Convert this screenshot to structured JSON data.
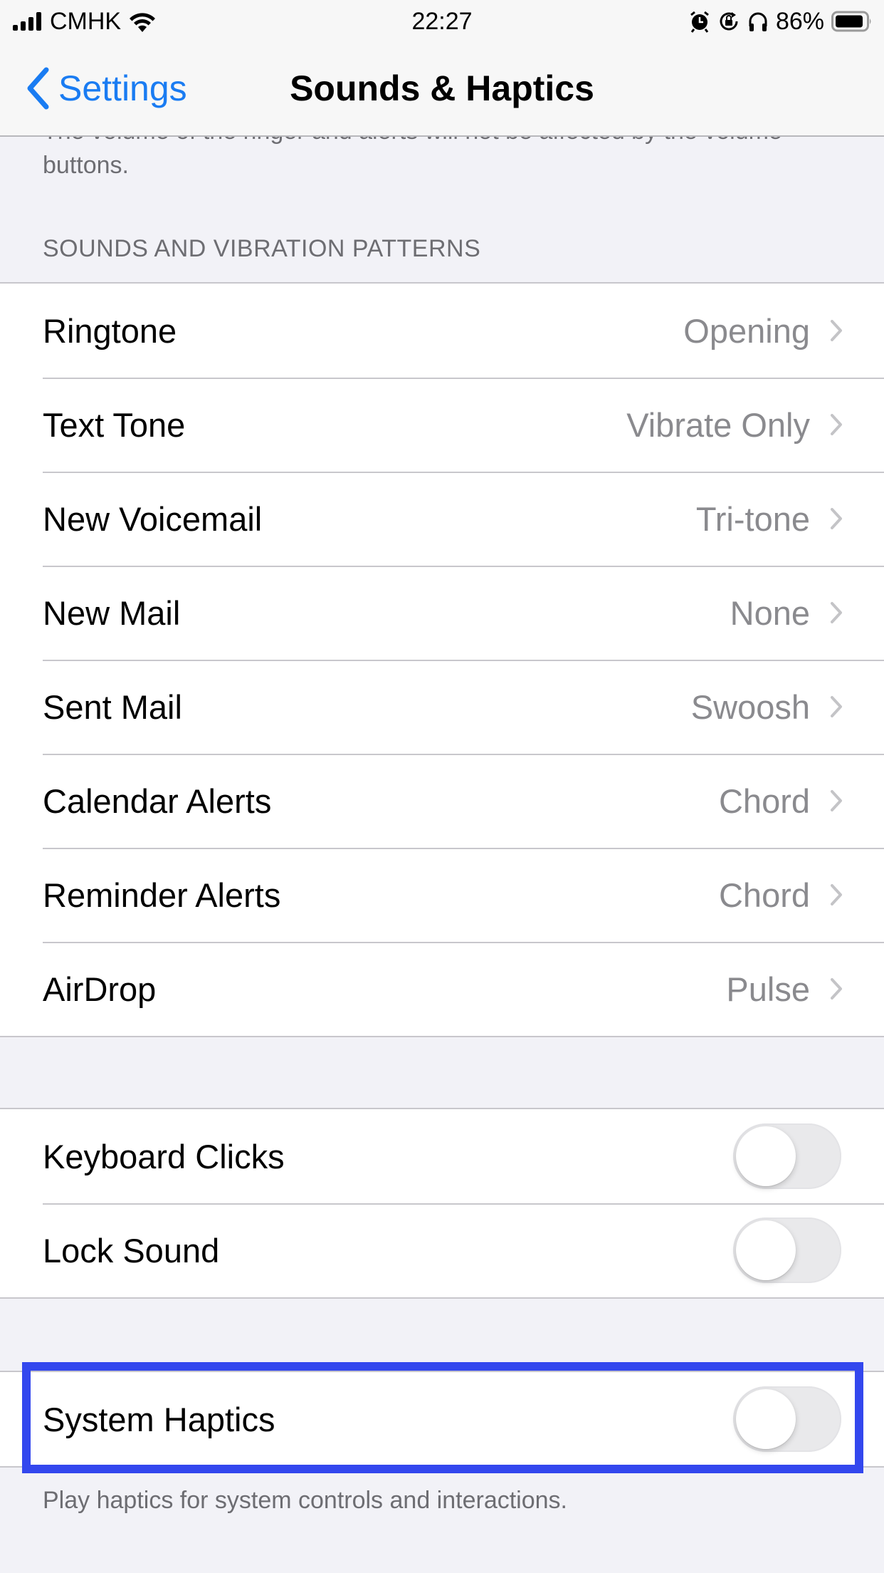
{
  "status_bar": {
    "carrier": "CMHK",
    "time": "22:27",
    "battery_percent": "86%",
    "icons": [
      "signal-icon",
      "wifi-icon",
      "alarm-icon",
      "orientation-lock-icon",
      "headphones-icon",
      "battery-icon"
    ]
  },
  "nav": {
    "back_label": "Settings",
    "title": "Sounds & Haptics"
  },
  "top_footnote": "The volume of the ringer and alerts will not be affected by the volume buttons.",
  "sounds_section": {
    "header": "SOUNDS AND VIBRATION PATTERNS",
    "rows": [
      {
        "label": "Ringtone",
        "value": "Opening"
      },
      {
        "label": "Text Tone",
        "value": "Vibrate Only"
      },
      {
        "label": "New Voicemail",
        "value": "Tri-tone"
      },
      {
        "label": "New Mail",
        "value": "None"
      },
      {
        "label": "Sent Mail",
        "value": "Swoosh"
      },
      {
        "label": "Calendar Alerts",
        "value": "Chord"
      },
      {
        "label": "Reminder Alerts",
        "value": "Chord"
      },
      {
        "label": "AirDrop",
        "value": "Pulse"
      }
    ]
  },
  "clicks_section": {
    "rows": [
      {
        "label": "Keyboard Clicks",
        "on": false
      },
      {
        "label": "Lock Sound",
        "on": false
      }
    ]
  },
  "haptics_section": {
    "rows": [
      {
        "label": "System Haptics",
        "on": false
      }
    ],
    "footer": "Play haptics for system controls and interactions.",
    "highlighted": true
  },
  "colors": {
    "accent": "#1a7cf2",
    "highlight": "#3347ee",
    "background": "#f2f2f7",
    "secondary_text": "#8a8a8e"
  }
}
